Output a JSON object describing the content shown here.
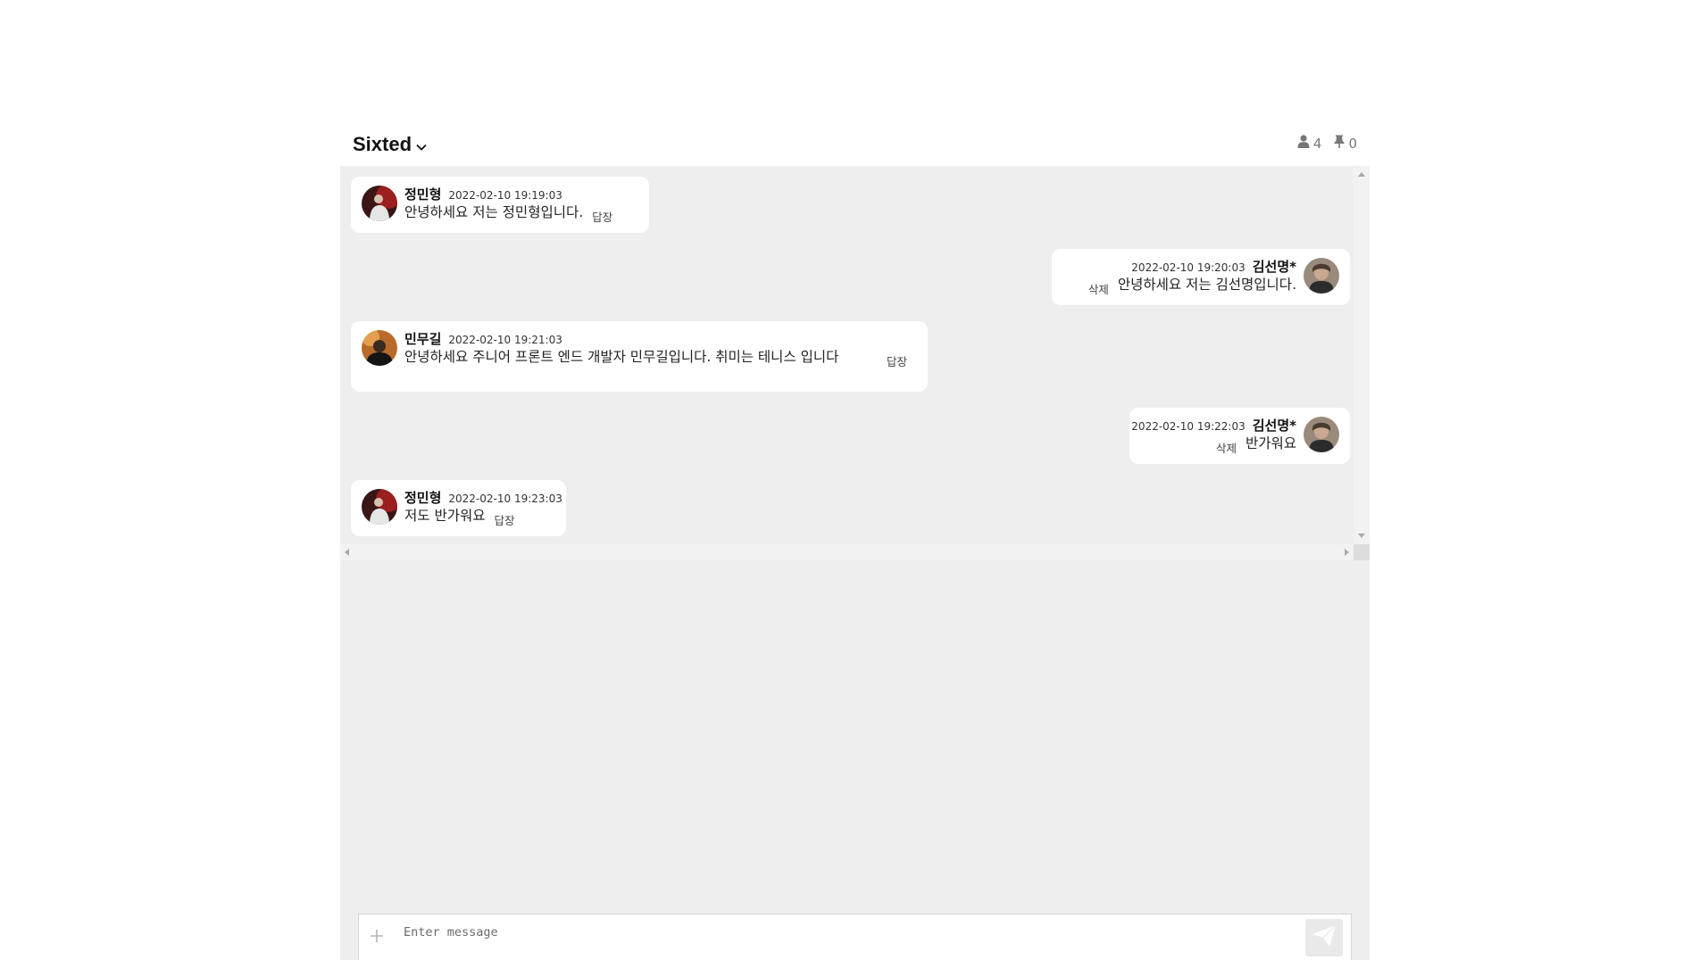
{
  "header": {
    "room_name": "Sixted",
    "member_count": "4",
    "pinned_count": "0"
  },
  "messages": [
    {
      "sender": "정민형",
      "time": "2022-02-10 19:19:03",
      "text": "안녕하세요 저는 정민형입니다.",
      "action": "답장",
      "side": "left"
    },
    {
      "sender": "김선명*",
      "time": "2022-02-10 19:20:03",
      "text": "안녕하세요 저는 김선명입니다.",
      "action": "삭제",
      "side": "right"
    },
    {
      "sender": "민무길",
      "time": "2022-02-10 19:21:03",
      "text": "안녕하세요 주니어 프론트 엔드 개발자 민무길입니다. 취미는 테니스 입니다",
      "action": "답장",
      "side": "left"
    },
    {
      "sender": "김선명*",
      "time": "2022-02-10 19:22:03",
      "text": "반가워요",
      "action": "삭제",
      "side": "right"
    },
    {
      "sender": "정민형",
      "time": "2022-02-10 19:23:03",
      "text": "저도 반가워요",
      "action": "답장",
      "side": "left"
    }
  ],
  "composer": {
    "placeholder": "Enter message"
  },
  "colors": {
    "chat_background": "#eeeeee",
    "bubble": "#ffffff"
  }
}
